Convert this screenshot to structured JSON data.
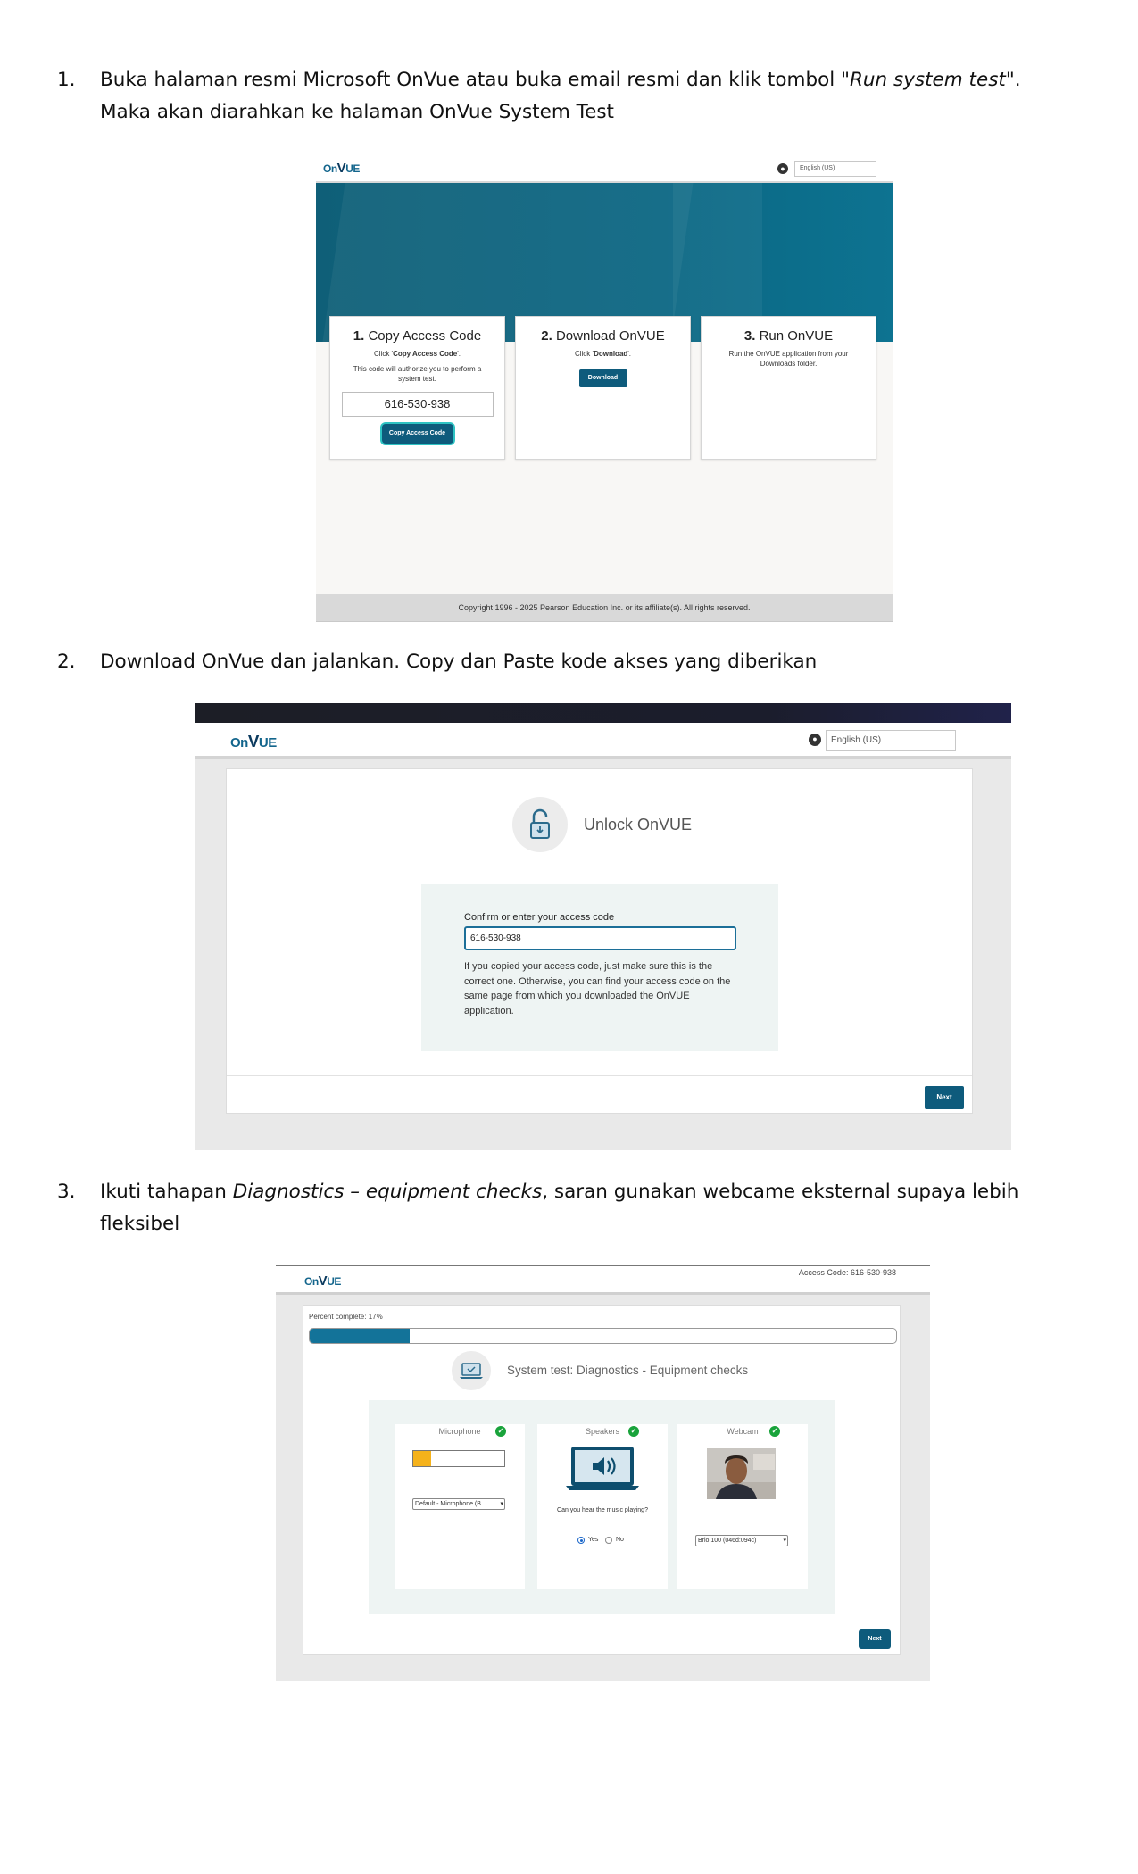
{
  "steps": [
    {
      "number": "1.",
      "line1_a": "Buka halaman resmi Microsoft OnVue atau buka email resmi dan klik tombol \"",
      "line1_italic": "Run system test",
      "line1_b": "\".",
      "line2": "Maka akan diarahkan ke halaman OnVue System Test"
    },
    {
      "number": "2.",
      "text": "Download OnVue dan jalankan. Copy dan Paste kode akses yang diberikan"
    },
    {
      "number": "3.",
      "text_a": "Ikuti tahapan ",
      "text_italic": "Diagnostics – equipment checks",
      "text_b": ", saran gunakan webcame eksternal supaya lebih",
      "line2": "fleksibel"
    }
  ],
  "screenshot1": {
    "logo_prefix": "On",
    "logo_v": "V",
    "logo_suffix": "UE",
    "language": "English (US)",
    "cards": [
      {
        "num": "1.",
        "title": "Copy Access Code",
        "sub_prefix": "Click '",
        "sub_bold": "Copy Access Code",
        "sub_suffix": "'.",
        "desc": "This code will authorize you to perform a system test.",
        "code": "616-530-938",
        "button": "Copy Access Code"
      },
      {
        "num": "2.",
        "title": "Download OnVUE",
        "sub_prefix": "Click '",
        "sub_bold": "Download",
        "sub_suffix": "'.",
        "button": "Download"
      },
      {
        "num": "3.",
        "title": "Run OnVUE",
        "desc": "Run the OnVUE application from your Downloads folder."
      }
    ],
    "footer": "Copyright 1996 - 2025 Pearson Education Inc. or its affiliate(s). All rights reserved."
  },
  "screenshot2": {
    "logo_prefix": "On",
    "logo_v": "V",
    "logo_suffix": "UE",
    "language": "English (US)",
    "title": "Unlock OnVUE",
    "field_label": "Confirm or enter your access code",
    "field_value": "616-530-938",
    "help_text": "If you copied your access code, just make sure this is the correct one. Otherwise, you can find your access code on the same page from which you downloaded the OnVUE application.",
    "next_button": "Next"
  },
  "screenshot3": {
    "logo_prefix": "On",
    "logo_v": "V",
    "logo_suffix": "UE",
    "access_code": "Access Code: 616-530-938",
    "percent_label": "Percent complete: 17%",
    "percent_value": 17,
    "title": "System test: Diagnostics - Equipment checks",
    "microphone": {
      "label": "Microphone",
      "level": 0.2,
      "select": "Default - Microphone (B"
    },
    "speakers": {
      "label": "Speakers",
      "question": "Can you hear the music playing?",
      "yes": "Yes",
      "no": "No",
      "selected": "Yes"
    },
    "webcam": {
      "label": "Webcam",
      "select": "Brio 100 (046d:094c)"
    },
    "next_button": "Next",
    "colors": {
      "progress": "#137399",
      "mic_level": "#f5b21b",
      "ok": "#19a33b",
      "button": "#0e5b7c"
    }
  }
}
